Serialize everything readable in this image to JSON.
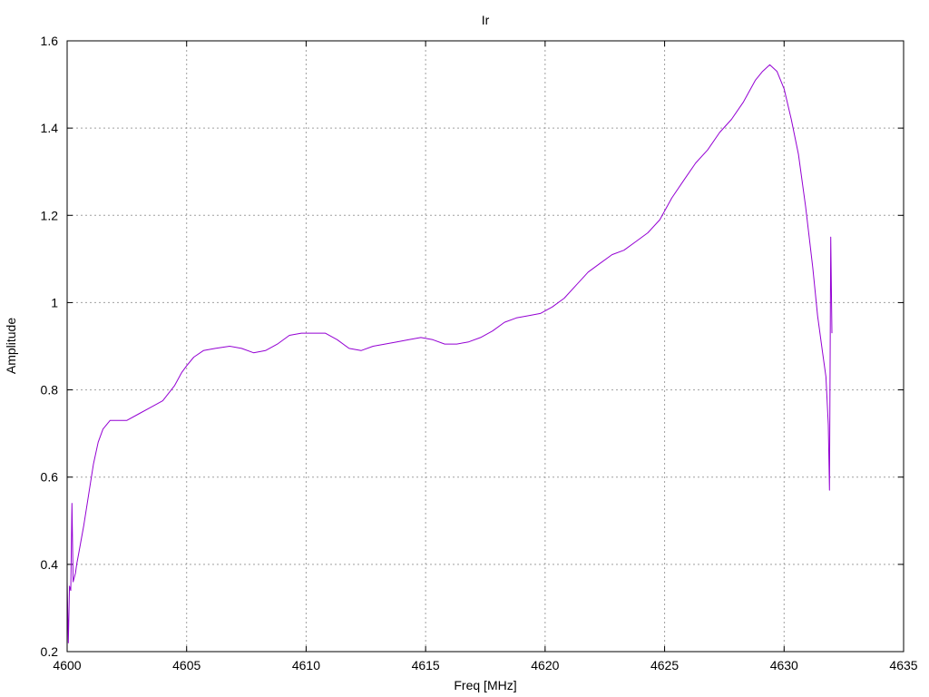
{
  "chart_data": {
    "type": "line",
    "title": "Ir",
    "xlabel": "Freq [MHz]",
    "ylabel": "Amplitude",
    "xlim": [
      4600,
      4635
    ],
    "ylim": [
      0.2,
      1.6
    ],
    "xticks": [
      4600,
      4605,
      4610,
      4615,
      4620,
      4625,
      4630,
      4635
    ],
    "yticks": [
      0.2,
      0.4,
      0.6,
      0.8,
      1.0,
      1.2,
      1.4,
      1.6
    ],
    "ytick_labels": [
      "0.2",
      "0.4",
      "0.6",
      "0.8",
      "1",
      "1.2",
      "1.4",
      "1.6"
    ],
    "grid": true,
    "series": [
      {
        "color": "#9400d3",
        "x": [
          4600.0,
          4600.05,
          4600.1,
          4600.15,
          4600.2,
          4600.25,
          4600.3,
          4600.35,
          4600.4,
          4600.5,
          4600.7,
          4600.9,
          4601.1,
          4601.3,
          4601.5,
          4601.8,
          4602.1,
          4602.5,
          4603.0,
          4603.5,
          4604.0,
          4604.5,
          4604.8,
          4605.0,
          4605.3,
          4605.7,
          4606.2,
          4606.8,
          4607.3,
          4607.8,
          4608.3,
          4608.8,
          4609.3,
          4609.8,
          4610.3,
          4610.8,
          4611.3,
          4611.8,
          4612.3,
          4612.8,
          4613.3,
          4613.8,
          4614.3,
          4614.8,
          4615.3,
          4615.8,
          4616.3,
          4616.8,
          4617.3,
          4617.8,
          4618.3,
          4618.8,
          4619.3,
          4619.8,
          4620.3,
          4620.8,
          4621.3,
          4621.8,
          4622.3,
          4622.8,
          4623.3,
          4623.8,
          4624.3,
          4624.8,
          4625.3,
          4625.8,
          4626.3,
          4626.8,
          4627.3,
          4627.8,
          4628.3,
          4628.8,
          4629.1,
          4629.4,
          4629.7,
          4630.0,
          4630.3,
          4630.6,
          4630.9,
          4631.2,
          4631.4,
          4631.6,
          4631.75,
          4631.85,
          4631.9,
          4631.95,
          4632.0
        ],
        "y": [
          0.36,
          0.22,
          0.35,
          0.34,
          0.54,
          0.36,
          0.37,
          0.38,
          0.4,
          0.43,
          0.49,
          0.56,
          0.63,
          0.68,
          0.71,
          0.73,
          0.73,
          0.73,
          0.745,
          0.76,
          0.775,
          0.81,
          0.84,
          0.855,
          0.875,
          0.89,
          0.895,
          0.9,
          0.895,
          0.885,
          0.89,
          0.905,
          0.925,
          0.93,
          0.93,
          0.93,
          0.915,
          0.895,
          0.89,
          0.9,
          0.905,
          0.91,
          0.915,
          0.92,
          0.915,
          0.905,
          0.905,
          0.91,
          0.92,
          0.935,
          0.955,
          0.965,
          0.97,
          0.975,
          0.99,
          1.01,
          1.04,
          1.07,
          1.09,
          1.11,
          1.12,
          1.14,
          1.16,
          1.19,
          1.24,
          1.28,
          1.32,
          1.35,
          1.39,
          1.42,
          1.46,
          1.51,
          1.53,
          1.545,
          1.53,
          1.49,
          1.42,
          1.34,
          1.22,
          1.08,
          0.97,
          0.89,
          0.83,
          0.72,
          0.57,
          1.15,
          0.93
        ]
      }
    ]
  }
}
